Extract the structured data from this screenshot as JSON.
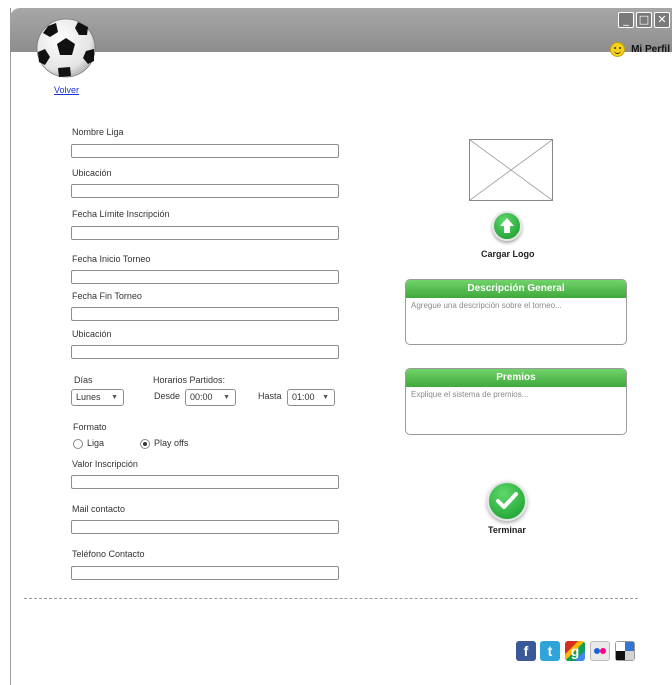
{
  "window": {
    "controls": [
      "_",
      "□",
      "✕"
    ],
    "profile_label": "Mi Perfil"
  },
  "nav": {
    "back_link": "Volver"
  },
  "form": {
    "fields": [
      {
        "label": "Nombre Liga",
        "value": ""
      },
      {
        "label": "Ubicación",
        "value": ""
      },
      {
        "label": "Fecha Límite Inscripción",
        "value": ""
      },
      {
        "label": "Fecha Inicio Torneo",
        "value": ""
      },
      {
        "label": "Fecha Fin Torneo",
        "value": ""
      },
      {
        "label": "Ubicación",
        "value": ""
      }
    ],
    "schedule": {
      "days_label": "Días",
      "days_value": "Lunes",
      "hours_label": "Horarios Partidos:",
      "from_label": "Desde",
      "from_value": "00:00",
      "to_label": "Hasta",
      "to_value": "01:00"
    },
    "format": {
      "label": "Formato",
      "options": [
        "Liga",
        "Play offs"
      ],
      "selected": "Play offs"
    },
    "extra_fields": [
      {
        "label": "Valor Inscripción",
        "value": ""
      },
      {
        "label": "Mail contacto",
        "value": ""
      },
      {
        "label": "Teléfono Contacto",
        "value": ""
      }
    ]
  },
  "logo": {
    "upload_label": "Cargar Logo"
  },
  "description": {
    "title": "Descripción General",
    "placeholder": "Agregue una descripción sobre el torneo..."
  },
  "prizes": {
    "title": "Premios",
    "placeholder": "Explique el sistema de premios..."
  },
  "finish": {
    "label": "Terminar"
  },
  "social": {
    "icons": [
      "facebook-icon",
      "twitter-icon",
      "google-plus-icon",
      "flickr-icon",
      "delicious-icon"
    ],
    "glyphs": [
      "f",
      "t",
      "g",
      "",
      ""
    ]
  }
}
